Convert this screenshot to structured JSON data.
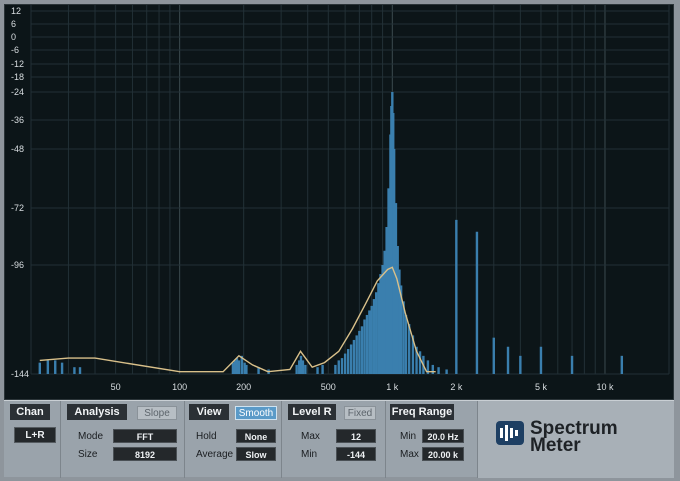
{
  "chart_data": {
    "type": "area",
    "x_scale": "log",
    "y_axis_ticks": [
      "12",
      "6",
      "0",
      "-6",
      "-12",
      "-18",
      "-24",
      "-36",
      "-48",
      "-72",
      "-96",
      "-144"
    ],
    "x_axis_ticks": [
      {
        "value": 50,
        "label": "50"
      },
      {
        "value": 100,
        "label": "100"
      },
      {
        "value": 200,
        "label": "200"
      },
      {
        "value": 500,
        "label": "500"
      },
      {
        "value": 1000,
        "label": "1 k"
      },
      {
        "value": 2000,
        "label": "2 k"
      },
      {
        "value": 5000,
        "label": "5 k"
      },
      {
        "value": 10000,
        "label": "10 k"
      }
    ],
    "xlim_hz": [
      20,
      20000
    ],
    "ylim_db": [
      -144,
      12
    ],
    "grid": true,
    "series": [
      {
        "style": "bars",
        "color": "#3a7fae",
        "points": [
          [
            22,
            -139
          ],
          [
            24,
            -138
          ],
          [
            26,
            -138
          ],
          [
            28,
            -139
          ],
          [
            32,
            -141
          ],
          [
            34,
            -141
          ],
          [
            178,
            -139
          ],
          [
            182,
            -138
          ],
          [
            186,
            -137
          ],
          [
            190,
            -138
          ],
          [
            196,
            -136
          ],
          [
            202,
            -139
          ],
          [
            206,
            -140
          ],
          [
            235,
            -141
          ],
          [
            262,
            -142
          ],
          [
            355,
            -140
          ],
          [
            365,
            -138
          ],
          [
            372,
            -136
          ],
          [
            380,
            -138
          ],
          [
            390,
            -140
          ],
          [
            445,
            -141
          ],
          [
            470,
            -140
          ],
          [
            540,
            -140
          ],
          [
            560,
            -138
          ],
          [
            580,
            -137
          ],
          [
            600,
            -135
          ],
          [
            620,
            -133
          ],
          [
            640,
            -131
          ],
          [
            660,
            -129
          ],
          [
            680,
            -127
          ],
          [
            700,
            -125
          ],
          [
            720,
            -123
          ],
          [
            740,
            -120
          ],
          [
            760,
            -118
          ],
          [
            780,
            -116
          ],
          [
            800,
            -114
          ],
          [
            820,
            -111
          ],
          [
            840,
            -108
          ],
          [
            860,
            -104
          ],
          [
            880,
            -100
          ],
          [
            900,
            -96
          ],
          [
            920,
            -90
          ],
          [
            940,
            -80
          ],
          [
            960,
            -64
          ],
          [
            980,
            -42
          ],
          [
            990,
            -30
          ],
          [
            1000,
            -24
          ],
          [
            1010,
            -33
          ],
          [
            1020,
            -48
          ],
          [
            1040,
            -70
          ],
          [
            1060,
            -88
          ],
          [
            1080,
            -98
          ],
          [
            1100,
            -105
          ],
          [
            1130,
            -112
          ],
          [
            1160,
            -118
          ],
          [
            1200,
            -122
          ],
          [
            1250,
            -127
          ],
          [
            1300,
            -132
          ],
          [
            1350,
            -134
          ],
          [
            1400,
            -136
          ],
          [
            1470,
            -138
          ],
          [
            1550,
            -140
          ],
          [
            1650,
            -141
          ],
          [
            1800,
            -142
          ],
          [
            2000,
            -77
          ],
          [
            2500,
            -82
          ],
          [
            3000,
            -128
          ],
          [
            3500,
            -132
          ],
          [
            4000,
            -136
          ],
          [
            5000,
            -132
          ],
          [
            7000,
            -136
          ],
          [
            12000,
            -136
          ]
        ]
      },
      {
        "style": "smooth-line",
        "color": "#d9c08a",
        "points": [
          [
            22,
            -138
          ],
          [
            30,
            -137
          ],
          [
            40,
            -137
          ],
          [
            100,
            -143
          ],
          [
            160,
            -143
          ],
          [
            190,
            -136
          ],
          [
            220,
            -140
          ],
          [
            260,
            -143
          ],
          [
            330,
            -142
          ],
          [
            370,
            -134
          ],
          [
            420,
            -141
          ],
          [
            480,
            -139
          ],
          [
            560,
            -134
          ],
          [
            650,
            -124
          ],
          [
            750,
            -113
          ],
          [
            850,
            -103
          ],
          [
            950,
            -98
          ],
          [
            1000,
            -97
          ],
          [
            1050,
            -102
          ],
          [
            1150,
            -117
          ],
          [
            1300,
            -134
          ],
          [
            1450,
            -143
          ],
          [
            1600,
            -143
          ]
        ]
      }
    ]
  },
  "panel": {
    "chan": {
      "title": "Chan",
      "button": "L+R"
    },
    "analysis": {
      "title": "Analysis",
      "toggle": "Slope",
      "mode_label": "Mode",
      "mode_value": "FFT",
      "size_label": "Size",
      "size_value": "8192"
    },
    "view": {
      "title": "View",
      "toggle": "Smooth",
      "hold_label": "Hold",
      "hold_value": "None",
      "average_label": "Average",
      "average_value": "Slow"
    },
    "level_r": {
      "title": "Level R",
      "toggle": "Fixed",
      "max_label": "Max",
      "max_value": "12",
      "min_label": "Min",
      "min_value": "-144"
    },
    "freq_range": {
      "title": "Freq Range",
      "min_label": "Min",
      "min_value": "20.0 Hz",
      "max_label": "Max",
      "max_value": "20.00 k"
    },
    "brand": {
      "line1": "Spectrum",
      "line2": "Meter"
    }
  }
}
